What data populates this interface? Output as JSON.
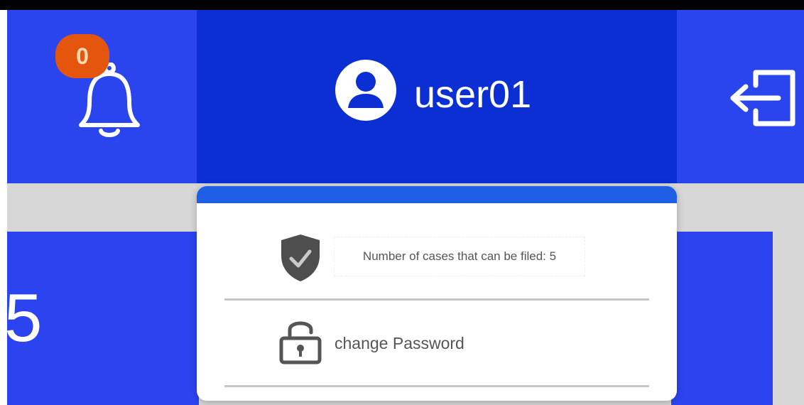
{
  "header": {
    "notifications": {
      "icon": "bell-icon",
      "badge_count": "0",
      "badge_color": "#e4560e"
    },
    "user": {
      "icon": "user-avatar-icon",
      "username": "user01"
    },
    "logout": {
      "icon": "logout-icon"
    },
    "colors": {
      "header_bg": "#2b45ee",
      "user_section_bg": "#0b2fd3"
    }
  },
  "dashboard": {
    "card_value": "5",
    "card_color": "#2c44f0"
  },
  "user_menu": {
    "accent": "#1f5fe6",
    "items": [
      {
        "icon": "shield-check-icon",
        "label": "Number of cases that can be filed: 5"
      },
      {
        "icon": "lock-icon",
        "label": "change Password"
      }
    ]
  }
}
